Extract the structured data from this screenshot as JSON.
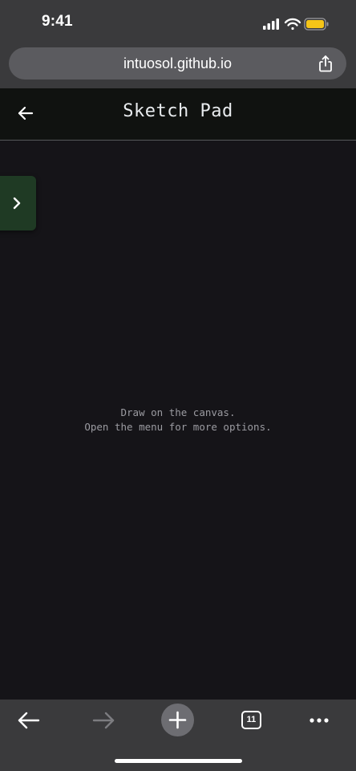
{
  "status_bar": {
    "time": "9:41",
    "icons": [
      "signal-icon",
      "wifi-icon",
      "battery-icon"
    ],
    "battery_color": "#f5c518"
  },
  "browser": {
    "url": "intuosol.github.io",
    "share_icon": "share-icon",
    "tab_count": "11"
  },
  "app": {
    "title": "Sketch Pad",
    "back_icon": "back-arrow-icon",
    "menu_toggle_icon": "chevron-right-icon",
    "accent_color": "#1f3a24"
  },
  "canvas": {
    "hint_line1": "Draw on the canvas.",
    "hint_line2": "Open the menu for more options."
  },
  "toolbar": {
    "items": [
      "back-icon",
      "forward-icon",
      "new-tab-icon",
      "tabs-icon",
      "more-icon"
    ]
  }
}
